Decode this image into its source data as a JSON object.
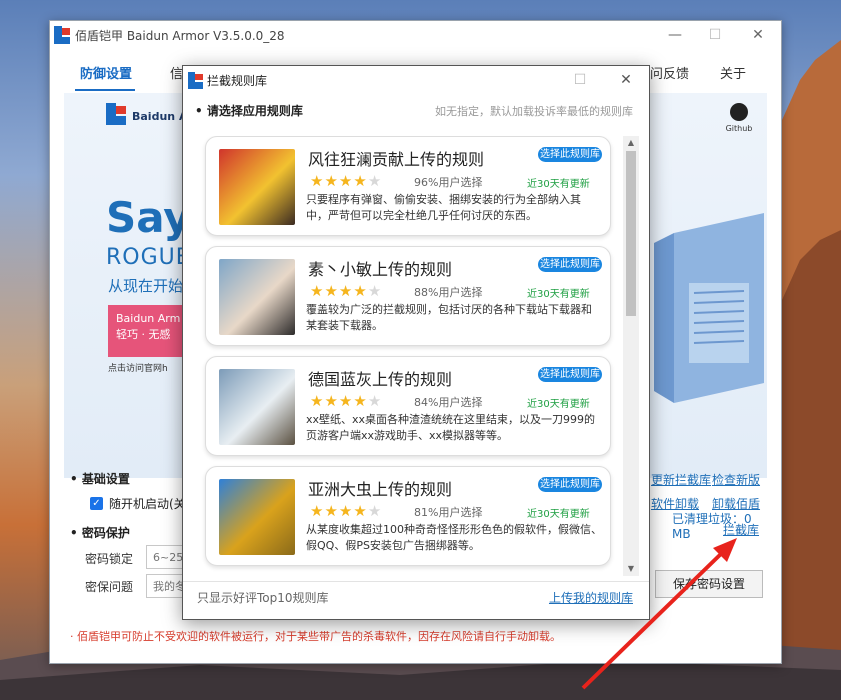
{
  "app": {
    "title": "佰盾铠甲 Baidun Armor  V3.5.0.0_28",
    "minimize": "—",
    "maximize": "☐",
    "close": "✕"
  },
  "tabs": [
    "防御设置",
    "信",
    "",
    "",
    "",
    "",
    "问反馈",
    "关于"
  ],
  "banner": {
    "brand": "Baidun Ar",
    "headline": "Say",
    "sub": "ROGUE",
    "start": "从现在开始",
    "pink_line1": "Baidun Arm",
    "pink_line2": "轻巧 · 无感",
    "visit": "点击访问官网h",
    "github": "Github",
    "cleared": "已清理垃圾：0 MB"
  },
  "settings": {
    "basic_title": "• 基础设置",
    "autostart": "随开机启动(关",
    "password_title": "• 密码保护",
    "lock_label": "密码锁定",
    "lock_placeholder": "6~25",
    "question_label": "密保问题",
    "question_placeholder": "我的冬",
    "links": {
      "update_rules": "更新拦截库",
      "check_version": "检查新版",
      "software_uninstall": "软件卸载",
      "uninstall_baidun": "卸载佰盾",
      "rule_library": "拦截库"
    },
    "save_password": "保存密码设置"
  },
  "footer_note": "· 佰盾铠甲可防止不受欢迎的软件被运行，对于某些带广告的杀毒软件，因存在风险请自行手动卸载。",
  "dialog": {
    "title": "拦截规则库",
    "maximize": "☐",
    "close": "✕",
    "choose": "• 请选择应用规则库",
    "hint": "如无指定，默认加载投诉率最低的规则库",
    "footer_left": "只显示好评Top10规则库",
    "footer_right": "上传我的规则库",
    "select_label": "选择此规则库",
    "recent": "近30天有更新",
    "cards": [
      {
        "title": "风往狂澜贡献上传的规则",
        "stars": 4,
        "pct": "96%用户选择",
        "desc": "只要程序有弹窗、偷偷安装、捆绑安装的行为全部纳入其中，严苛但可以完全杜绝几乎任何讨厌的东西。",
        "img_colors": [
          "#d0342c",
          "#f2c230",
          "#3a2a22"
        ]
      },
      {
        "title": "素丶小敏上传的规则",
        "stars": 4,
        "pct": "88%用户选择",
        "desc": "覆盖较为广泛的拦截规则，包括讨厌的各种下载站下载器和某套装下载器。",
        "img_colors": [
          "#7fa6c8",
          "#e8d8c8",
          "#2c2a2a"
        ]
      },
      {
        "title": "德国蓝灰上传的规则",
        "stars": 4,
        "pct": "84%用户选择",
        "desc": "xx壁纸、xx桌面各种渣渣统统在这里结束，以及一刀999的页游客户端xx游戏助手、xx模拟器等等。",
        "img_colors": [
          "#7c9bb8",
          "#e8eef2",
          "#5a5040"
        ]
      },
      {
        "title": "亚洲大虫上传的规则",
        "stars": 4,
        "pct": "81%用户选择",
        "desc": "从某度收集超过100种奇奇怪怪形形色色的假软件，假微信、假QQ、假PS安装包广告捆绑器等。",
        "img_colors": [
          "#2f80d8",
          "#d9a21c",
          "#8a6a1a"
        ]
      }
    ]
  }
}
